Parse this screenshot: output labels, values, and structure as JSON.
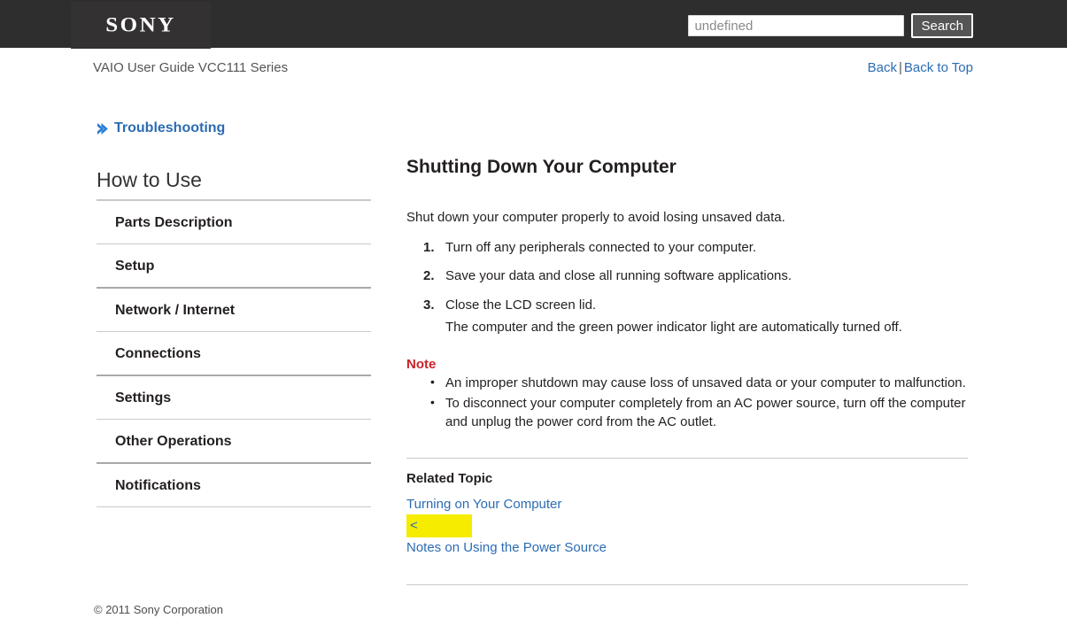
{
  "header": {
    "logo": "SONY",
    "logo_icon": "sony-wordmark",
    "search": {
      "value": "undefined",
      "placeholder": "undefined",
      "button_label": "Search",
      "icon": "search-icon"
    }
  },
  "title_row": {
    "guide_title": "VAIO User Guide VCC111 Series",
    "back_label": "Back",
    "separator": "|",
    "back_to_top_label": "Back to Top"
  },
  "sidebar": {
    "troubleshooting": {
      "label": "Troubleshooting",
      "icon": "chevron-right-icon"
    },
    "section_heading": "How to Use",
    "items": [
      {
        "label": "Parts Description"
      },
      {
        "label": "Setup"
      },
      {
        "label": "Network / Internet"
      },
      {
        "label": "Connections"
      },
      {
        "label": "Settings"
      },
      {
        "label": "Other Operations"
      },
      {
        "label": "Notifications"
      }
    ]
  },
  "main": {
    "heading": "Shutting Down Your Computer",
    "intro": "Shut down your computer properly to avoid losing unsaved data.",
    "steps": [
      {
        "text": "Turn off any peripherals connected to your computer.",
        "sub": ""
      },
      {
        "text": "Save your data and close all running software applications.",
        "sub": ""
      },
      {
        "text": "Close the LCD screen lid.",
        "sub": "The computer and the green power indicator light are automatically turned off."
      }
    ],
    "note": {
      "heading": "Note",
      "items": [
        "An improper shutdown may cause loss of unsaved data or your computer to malfunction.",
        "To disconnect your computer completely from an AC power source, turn off the computer and unplug the power cord from the AC outlet."
      ]
    },
    "related": {
      "heading": "Related Topic",
      "link_1": "Turning on Your Computer",
      "highlighted_text": "<",
      "link_2": "Notes on Using the Power Source"
    }
  },
  "footer": {
    "copyright": "© 2011 Sony Corporation"
  },
  "colors": {
    "header_bg": "#2e2e2e",
    "link_blue": "#2b6cb4",
    "note_red": "#cc2229",
    "highlight_yellow": "#f5ec00",
    "rule_gray": "#c9c9c9"
  }
}
